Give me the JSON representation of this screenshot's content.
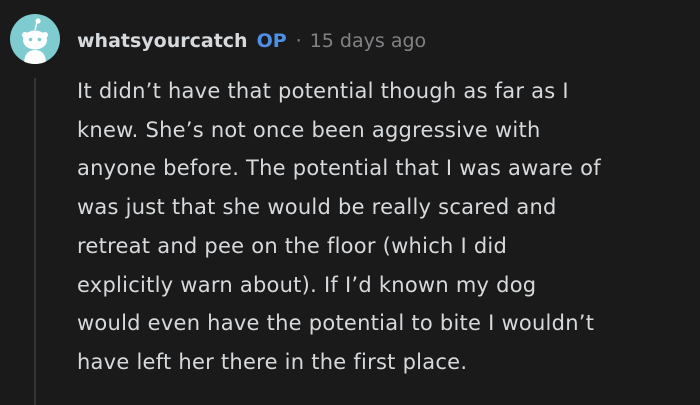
{
  "comment": {
    "author": "whatsyourcatch",
    "op_badge": "OP",
    "separator": "·",
    "timestamp": "15 days ago",
    "avatar_icon": "reddit-snoo-avatar-icon",
    "body_lines": [
      "It didn’t have that potential though as far as I",
      "knew. She’s not once been aggressive with",
      "anyone before. The potential that I was aware of",
      "was just that she would be really scared and",
      "retreat and pee on the floor (which I did",
      "explicitly warn about). If I’d known my dog",
      "would even have the potential to bite I wouldn’t",
      "have left her there in the first place."
    ]
  },
  "colors": {
    "background": "#1a1a1b",
    "text": "#d7dadc",
    "meta": "#818384",
    "op": "#4f8fe6",
    "avatar": "#7eccd0",
    "thread_line": "#343536"
  }
}
